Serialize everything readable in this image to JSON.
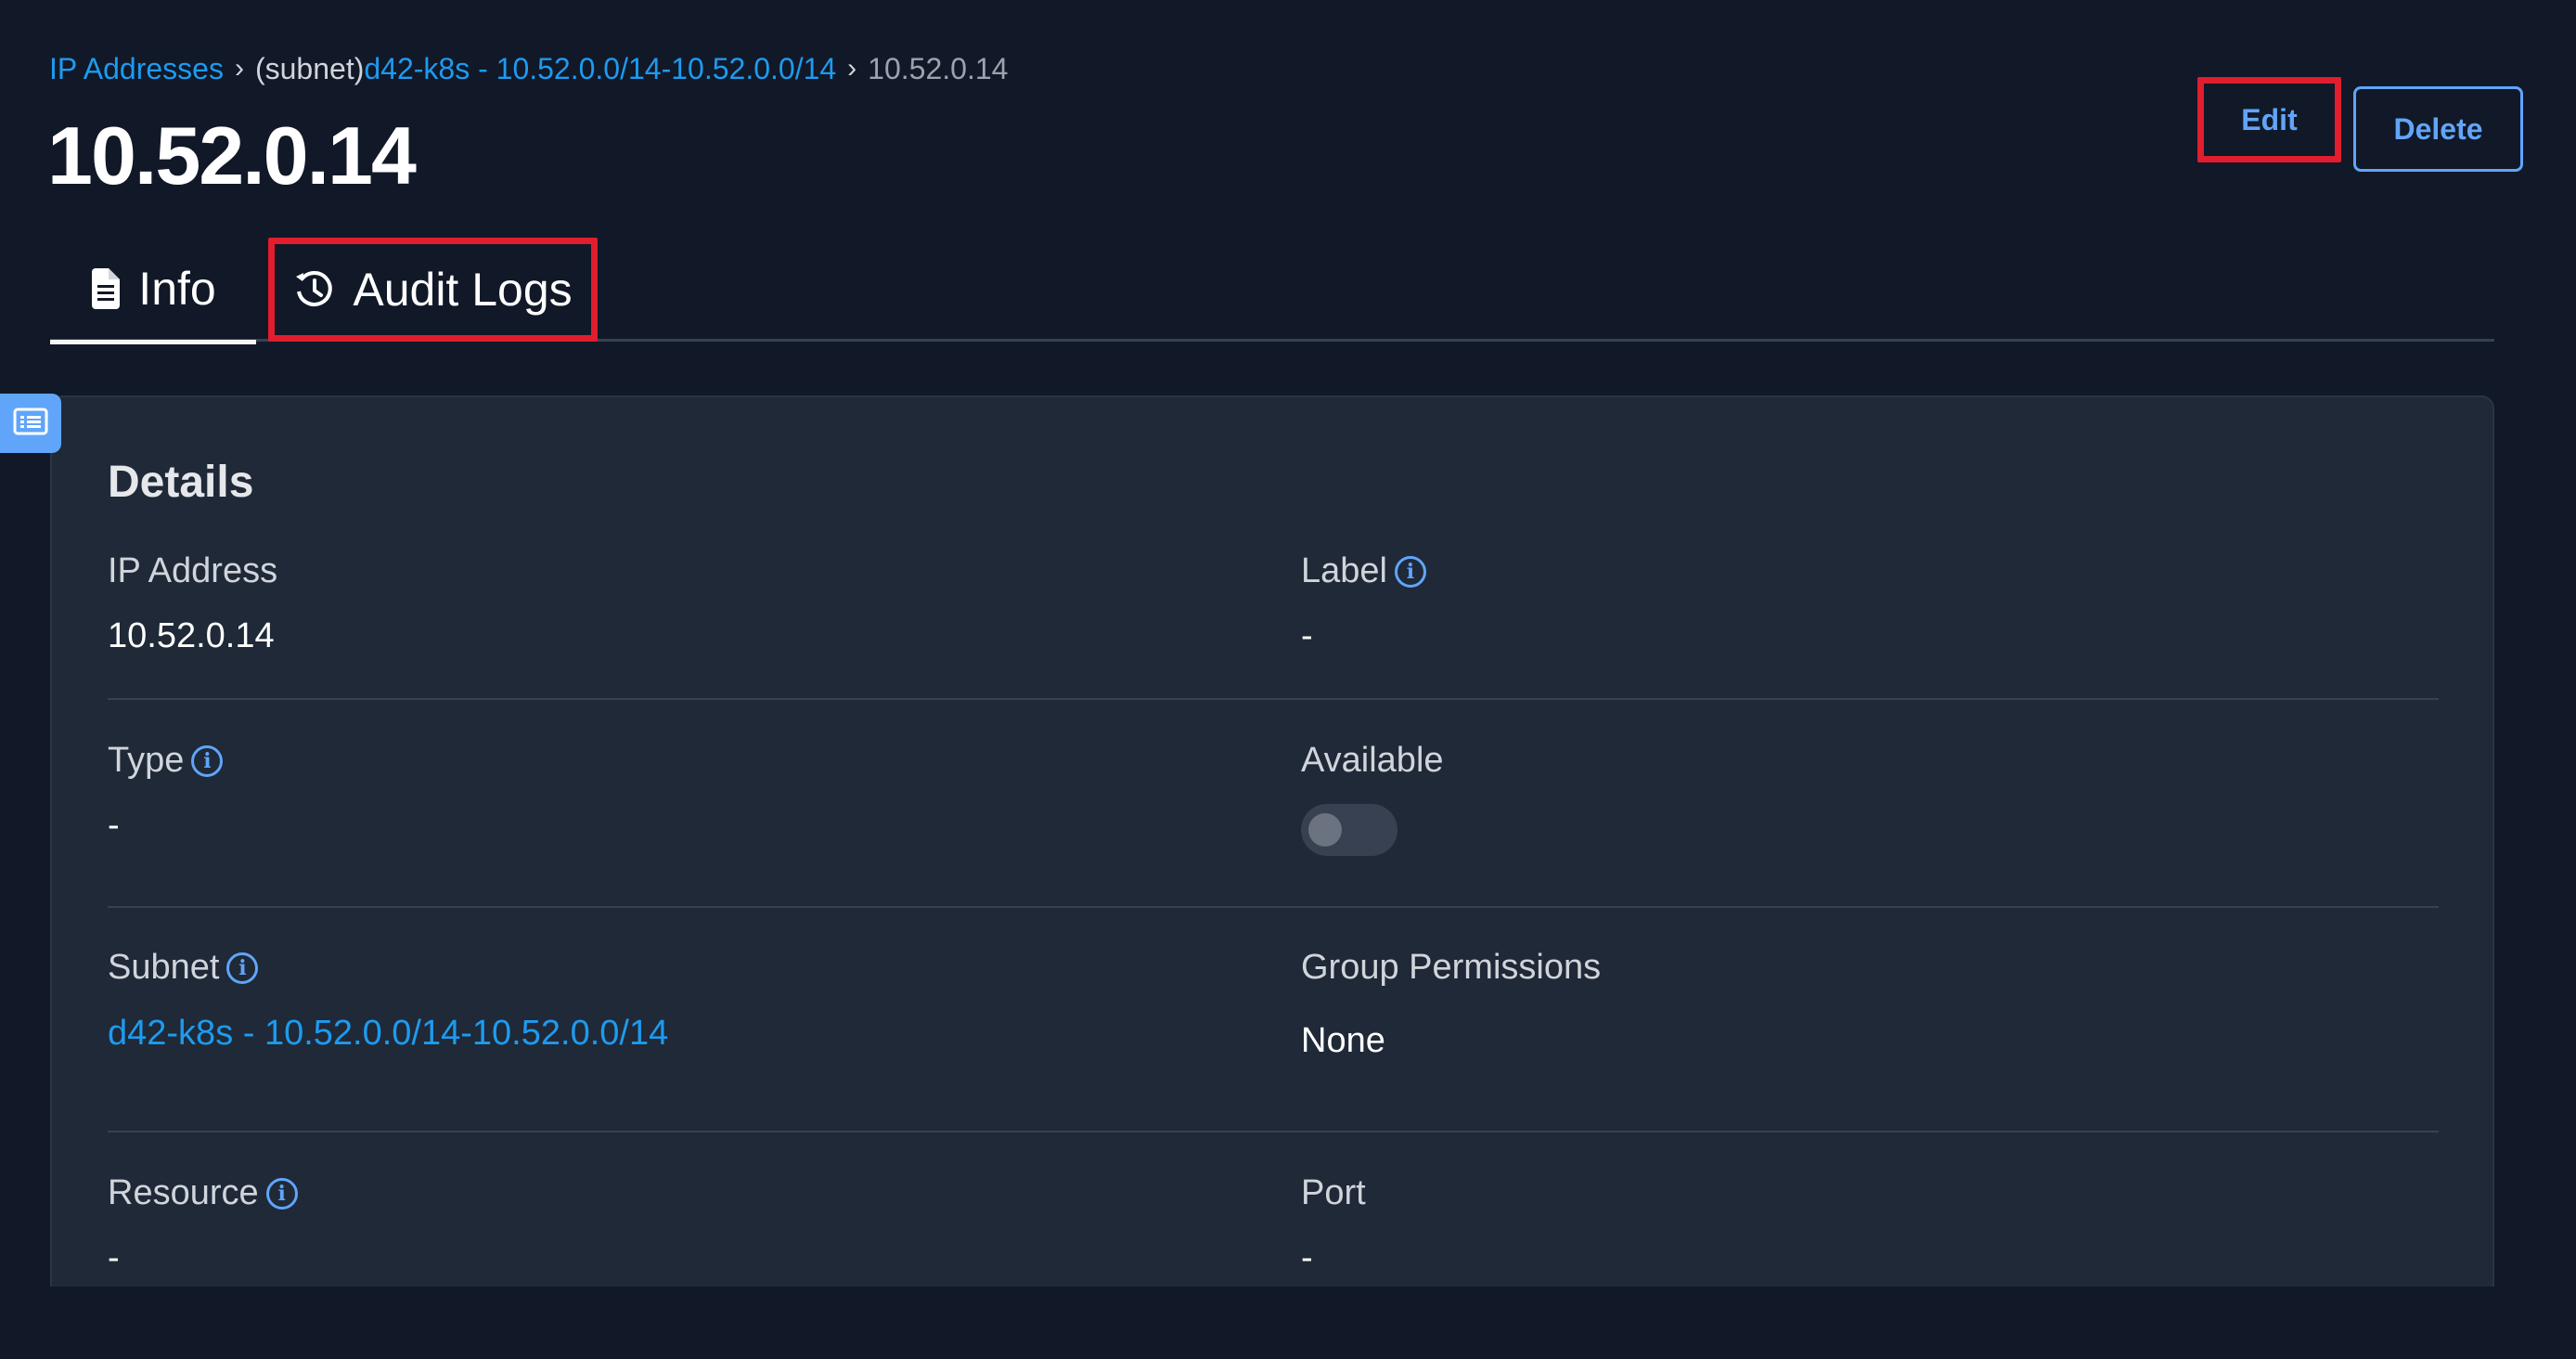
{
  "breadcrumb": {
    "root": "IP Addresses",
    "separator": "›",
    "subnet_prefix": "(subnet)",
    "subnet": "d42-k8s - 10.52.0.0/14-10.52.0.0/14",
    "current": "10.52.0.14"
  },
  "page_title": "10.52.0.14",
  "header_buttons": {
    "edit": "Edit",
    "delete": "Delete"
  },
  "tabs": [
    {
      "label": "Info",
      "icon": "document-icon",
      "active": true
    },
    {
      "label": "Audit Logs",
      "icon": "history-icon",
      "active": false
    }
  ],
  "details": {
    "title": "Details",
    "fields": {
      "ip_address": {
        "label": "IP Address",
        "value": "10.52.0.14"
      },
      "label": {
        "label": "Label",
        "value": "-"
      },
      "type": {
        "label": "Type",
        "value": "-"
      },
      "available": {
        "label": "Available",
        "value": false
      },
      "subnet": {
        "label": "Subnet",
        "value": "d42-k8s - 10.52.0.0/14-10.52.0.0/14"
      },
      "group_permissions": {
        "label": "Group Permissions",
        "value": "None"
      },
      "resource": {
        "label": "Resource",
        "value": "-"
      },
      "port": {
        "label": "Port",
        "value": "-"
      }
    }
  },
  "colors": {
    "background": "#111827",
    "card": "#1f2937",
    "link": "#1d9bf0",
    "accent": "#60a5fa",
    "highlight": "#e11d2e"
  }
}
